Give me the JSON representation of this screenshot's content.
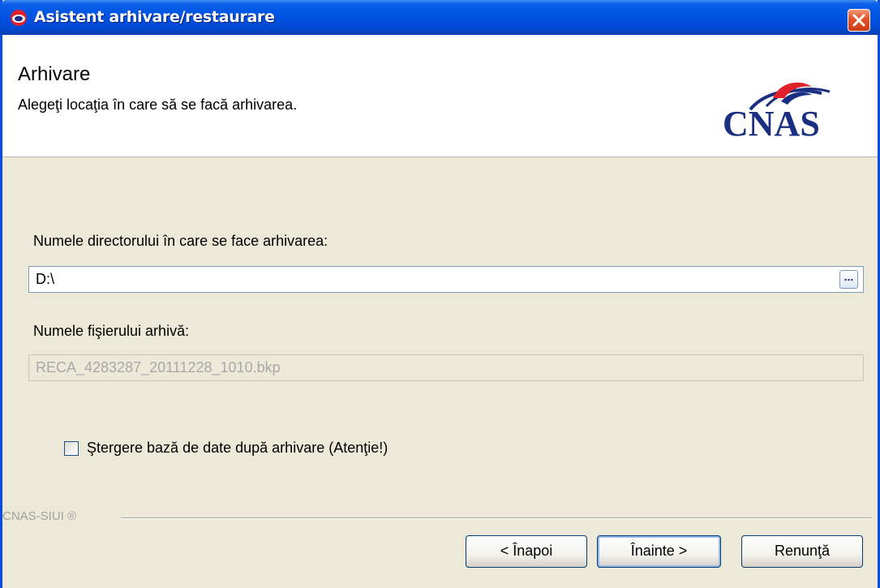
{
  "window": {
    "title": "Asistent arhivare/restaurare"
  },
  "header": {
    "title": "Arhivare",
    "subtitle": "Alegeţi locaţia în care să se facă arhivarea.",
    "logo_text": "CNAS"
  },
  "form": {
    "directory_label": "Numele directorului în care se face arhivarea:",
    "directory_value": "D:\\",
    "browse_label": "...",
    "archive_label": "Numele fişierului arhivă:",
    "archive_value": "RECA_4283287_20111228_1010.bkp",
    "delete_checkbox_label": "Ştergere bază de date după arhivare (Atenţie!)",
    "delete_checked": false
  },
  "footer": {
    "brand": "CNAS-SIUI ®",
    "back_label": "< Înapoi",
    "next_label": "Înainte >",
    "cancel_label": "Renunţă"
  },
  "colors": {
    "titlebar": "#0054e3",
    "window_bg": "#ece9d8",
    "logo_blue": "#1b2f82",
    "logo_red": "#e0202a"
  }
}
